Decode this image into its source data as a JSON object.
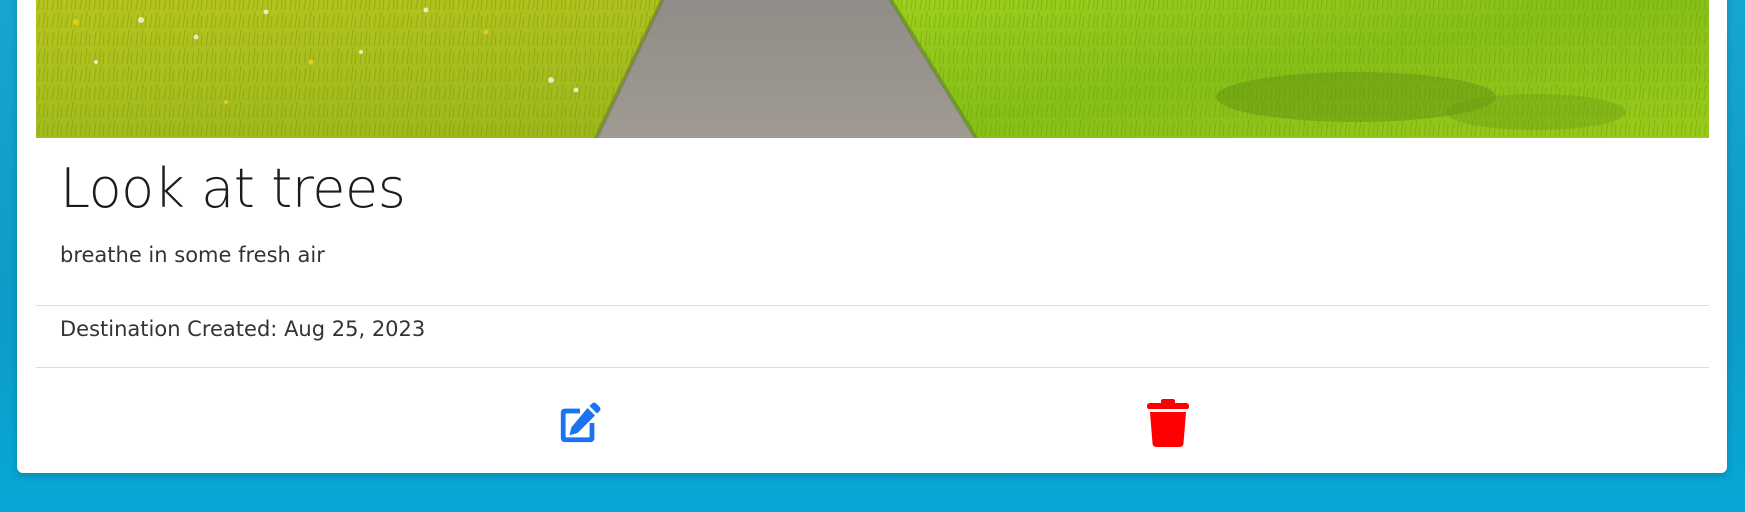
{
  "card": {
    "image_alt": "Paved path through a green grassy meadow",
    "title": "Look at trees",
    "description": "breathe in some fresh air",
    "created_label": "Destination Created:",
    "created_date": "Aug 25, 2023",
    "actions": [
      {
        "icon": "edit-icon",
        "color": "#1a73f0"
      },
      {
        "icon": "trash-icon",
        "color": "#ff0000"
      }
    ]
  },
  "colors": {
    "background": "#0d9cc8",
    "edit": "#1a73f0",
    "delete": "#ff0000"
  }
}
